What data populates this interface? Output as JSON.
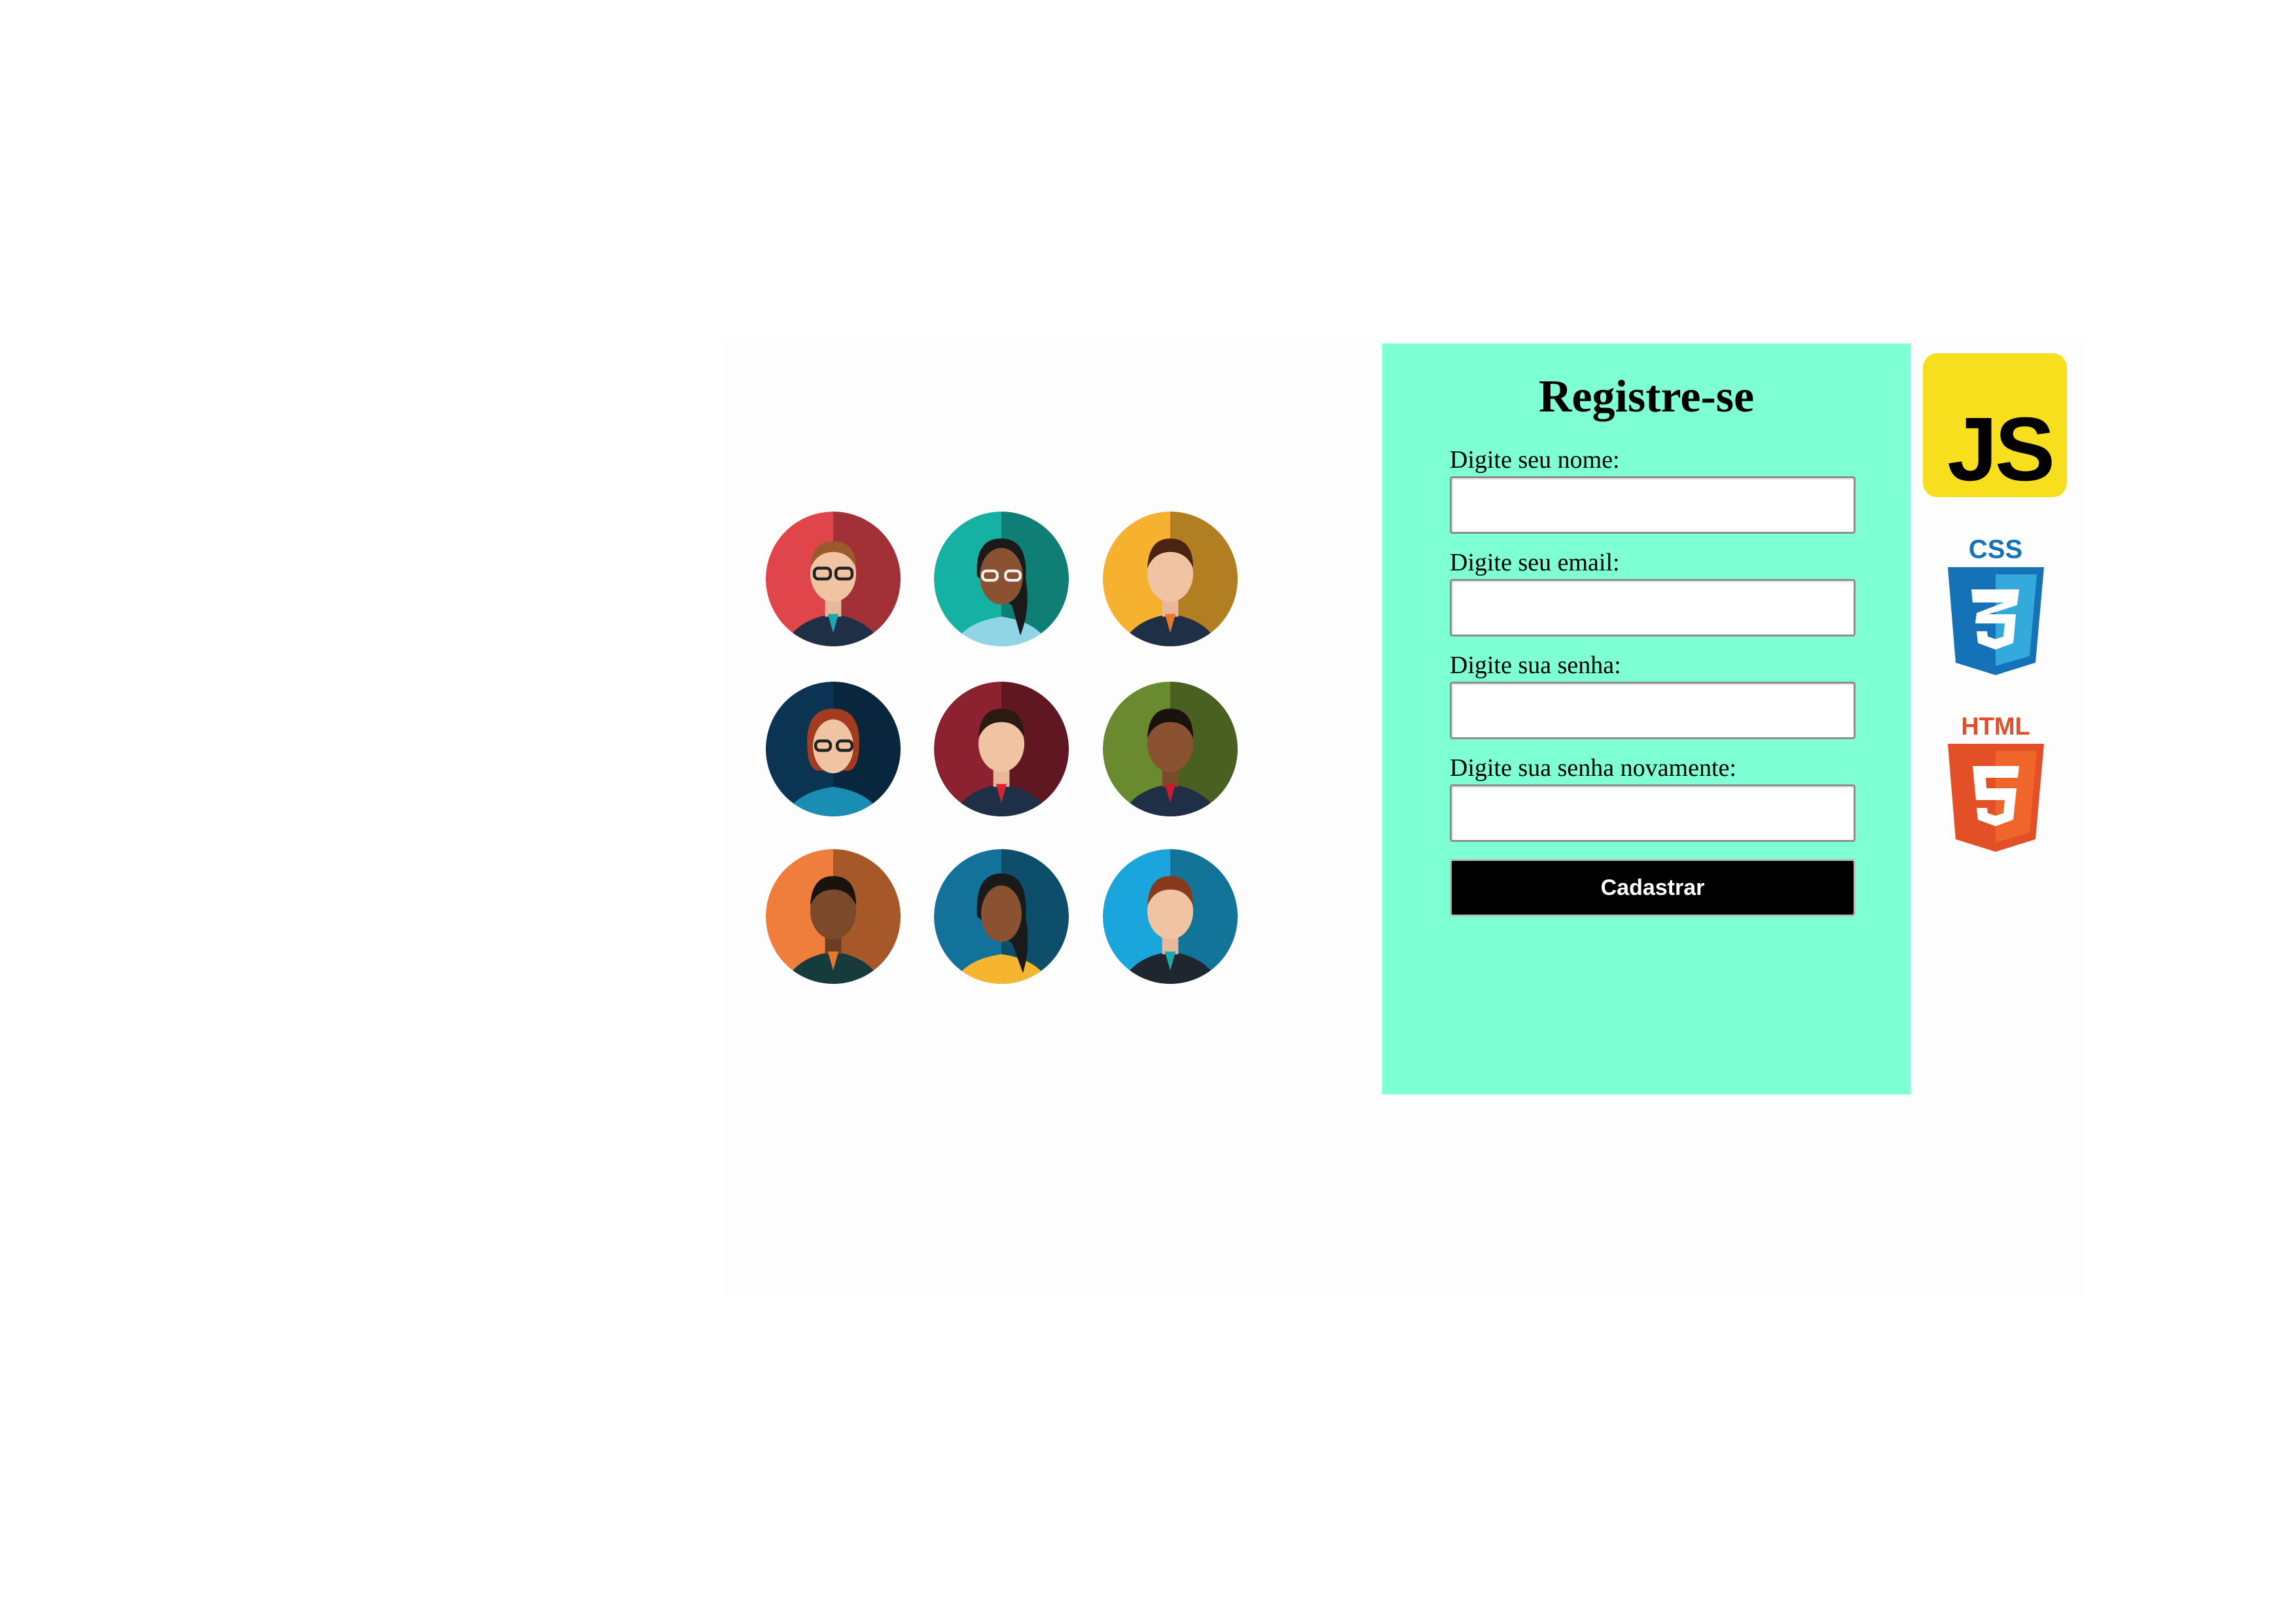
{
  "form": {
    "title": "Registre-se",
    "fields": [
      {
        "label": "Digite seu nome:",
        "value": ""
      },
      {
        "label": "Digite seu email:",
        "value": ""
      },
      {
        "label": "Digite sua senha:",
        "value": ""
      },
      {
        "label": "Digite sua senha novamente:",
        "value": ""
      }
    ],
    "submit_label": "Cadastrar"
  },
  "logos": {
    "js_text": "JS",
    "css_text": "CSS",
    "html_text": "HTML"
  },
  "colors": {
    "panel_background": "#7fffd4",
    "button_background": "#000000",
    "js_yellow": "#f7df1e",
    "css_blue": "#1572b6",
    "html_orange": "#e34f26"
  },
  "avatars": [
    {
      "icon": "man-glasses-avatar-icon",
      "color": "#e0454b"
    },
    {
      "icon": "woman-glasses-avatar-icon",
      "color": "#15b1a2"
    },
    {
      "icon": "man-avatar-icon",
      "color": "#f6b12e"
    },
    {
      "icon": "woman-glasses-avatar-icon",
      "color": "#0b3352"
    },
    {
      "icon": "man-avatar-icon",
      "color": "#8c2230"
    },
    {
      "icon": "man-avatar-icon",
      "color": "#6a8a2f"
    },
    {
      "icon": "man-avatar-icon",
      "color": "#ef7e3c"
    },
    {
      "icon": "woman-avatar-icon",
      "color": "#13729a"
    },
    {
      "icon": "man-avatar-icon",
      "color": "#1aa6dc"
    }
  ]
}
